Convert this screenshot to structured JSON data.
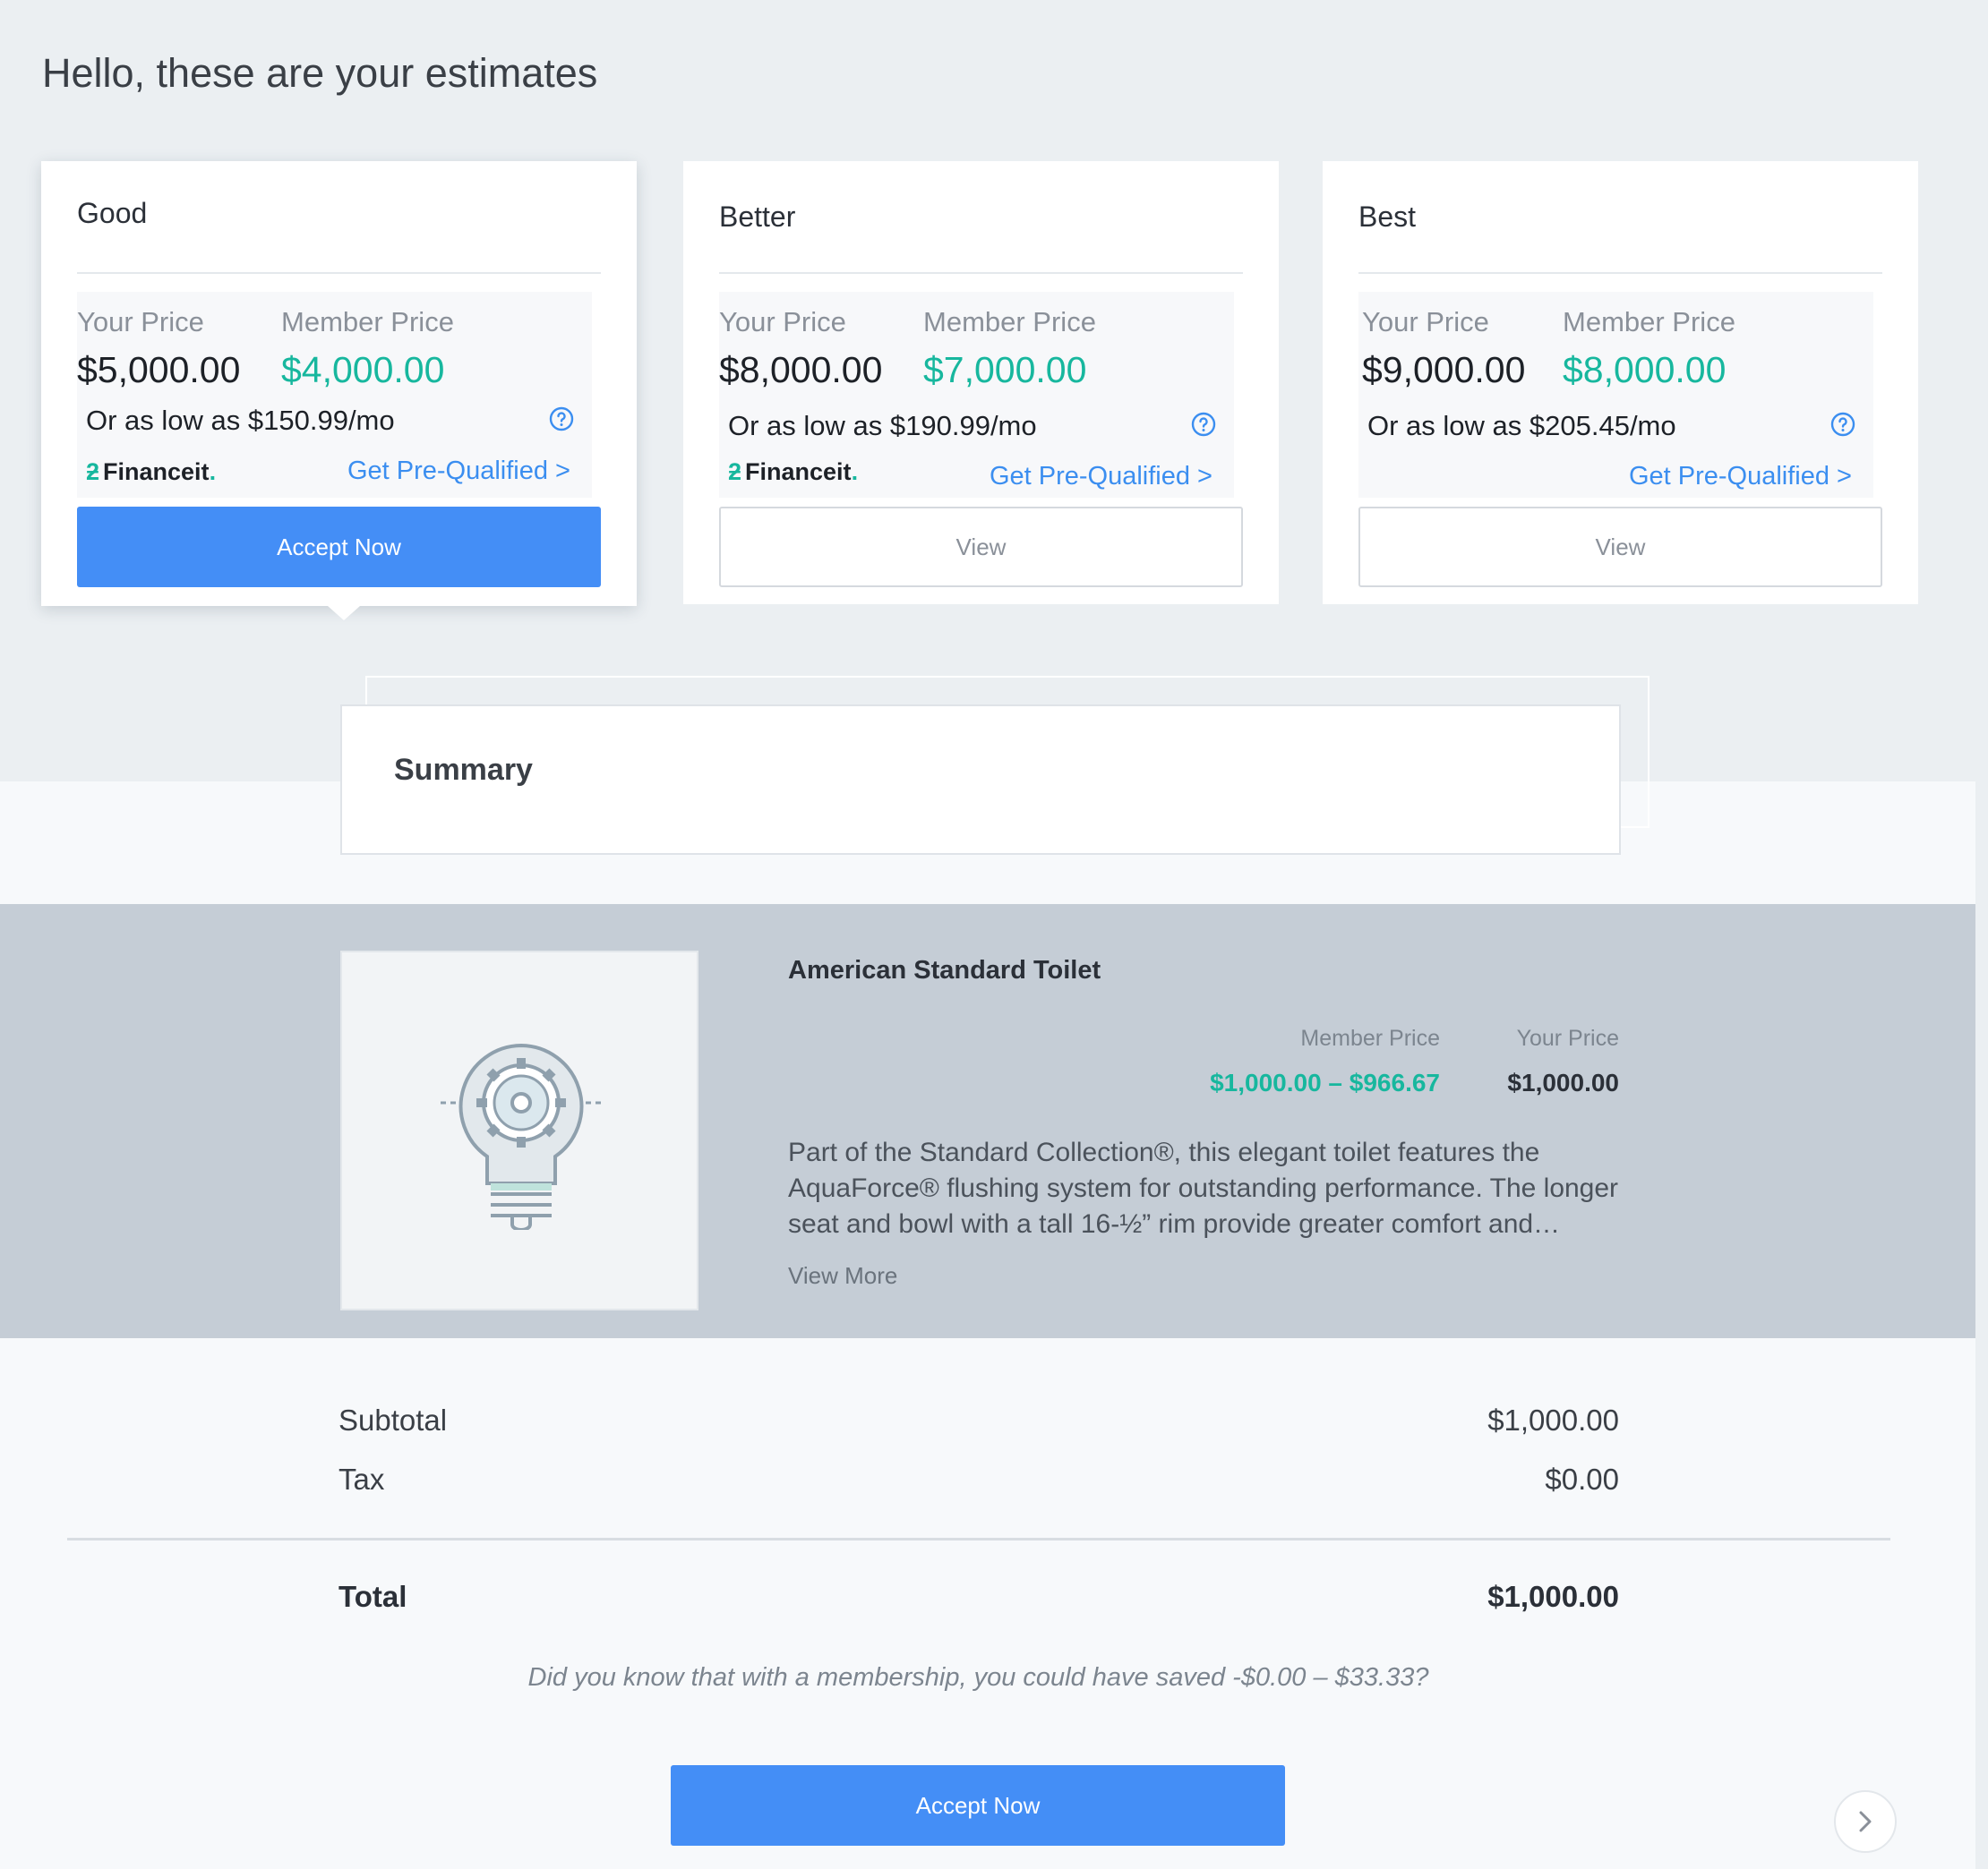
{
  "page": {
    "title": "Hello, these are your estimates"
  },
  "tiers": [
    {
      "name": "Good",
      "your_price_label": "Your Price",
      "your_price": "$5,000.00",
      "member_price_label": "Member Price",
      "member_price": "$4,000.00",
      "monthly": "Or as low as $150.99/mo",
      "financer": "Financeit",
      "prequal_link": "Get Pre-Qualified >",
      "button_label": "Accept Now"
    },
    {
      "name": "Better",
      "your_price_label": "Your Price",
      "your_price": "$8,000.00",
      "member_price_label": "Member Price",
      "member_price": "$7,000.00",
      "monthly": "Or as low as $190.99/mo",
      "financer": "Financeit",
      "prequal_link": "Get Pre-Qualified >",
      "button_label": "View"
    },
    {
      "name": "Best",
      "your_price_label": "Your Price",
      "your_price": "$9,000.00",
      "member_price_label": "Member Price",
      "member_price": "$8,000.00",
      "monthly": "Or as low as $205.45/mo",
      "prequal_link": "Get Pre-Qualified >",
      "button_label": "View"
    }
  ],
  "summary": {
    "title": "Summary"
  },
  "product": {
    "name": "American Standard Toilet",
    "member_price_label": "Member Price",
    "your_price_label": "Your Price",
    "member_price_range": "$1,000.00 – $966.67",
    "your_price": "$1,000.00",
    "description": "Part of the Standard Collection®, this elegant toilet features the AquaForce® flushing system for outstanding performance. The longer seat and bowl with a tall 16-½” rim provide greater comfort and…",
    "view_more": "View More",
    "image_icon": "lightbulb-gear-icon"
  },
  "totals": {
    "subtotal_label": "Subtotal",
    "subtotal": "$1,000.00",
    "tax_label": "Tax",
    "tax": "$0.00",
    "total_label": "Total",
    "total": "$1,000.00"
  },
  "savings_note": "Did you know that with a membership, you could have saved -$0.00 – $33.33?",
  "footer": {
    "accept_label": "Accept Now",
    "next_icon": "chevron-right-icon"
  },
  "colors": {
    "accent": "#448ef6",
    "member_green": "#17b79e",
    "link_blue": "#3b8ef0",
    "band": "#c5cdd6"
  }
}
